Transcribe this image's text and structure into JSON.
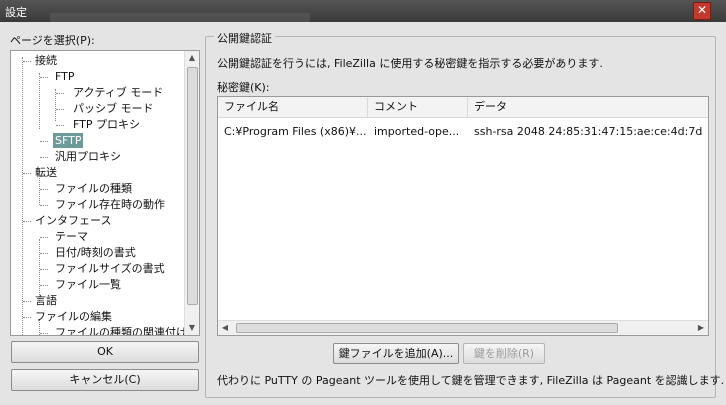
{
  "window": {
    "title": "設定"
  },
  "left": {
    "page_select_label": "ページを選択(P):",
    "tree": [
      {
        "label": "接続"
      },
      {
        "label": "FTP"
      },
      {
        "label": "アクティブ モード"
      },
      {
        "label": "パッシブ モード"
      },
      {
        "label": "FTP プロキシ"
      },
      {
        "label": "SFTP",
        "selected": true
      },
      {
        "label": "汎用プロキシ"
      },
      {
        "label": "転送"
      },
      {
        "label": "ファイルの種類"
      },
      {
        "label": "ファイル存在時の動作"
      },
      {
        "label": "インタフェース"
      },
      {
        "label": "テーマ"
      },
      {
        "label": "日付/時刻の書式"
      },
      {
        "label": "ファイルサイズの書式"
      },
      {
        "label": "ファイル一覧"
      },
      {
        "label": "言語"
      },
      {
        "label": "ファイルの編集"
      },
      {
        "label": "ファイルの種類の関連付け"
      }
    ],
    "ok_label": "OK",
    "cancel_label": "キャンセル(C)"
  },
  "main": {
    "group_title": "公開鍵認証",
    "description": "公開鍵認証を行うには, FileZilla に使用する秘密鍵を指示する必要があります.",
    "keys_label": "秘密鍵(K):",
    "columns": [
      "ファイル名",
      "コメント",
      "データ"
    ],
    "rows": [
      [
        "C:¥Program Files (x86)¥...",
        "imported-ope...",
        "ssh-rsa 2048 24:85:31:47:15:ae:ce:4d:7d"
      ]
    ],
    "add_key_label": "鍵ファイルを追加(A)...",
    "remove_key_label": "鍵を削除(R)",
    "footer_note": "代わりに PuTTY の Pageant ツールを使用して鍵を管理できます, FileZilla は Pageant を認識します."
  },
  "icons": {
    "close": "close-icon",
    "cursor": "mouse-cursor-icon"
  }
}
